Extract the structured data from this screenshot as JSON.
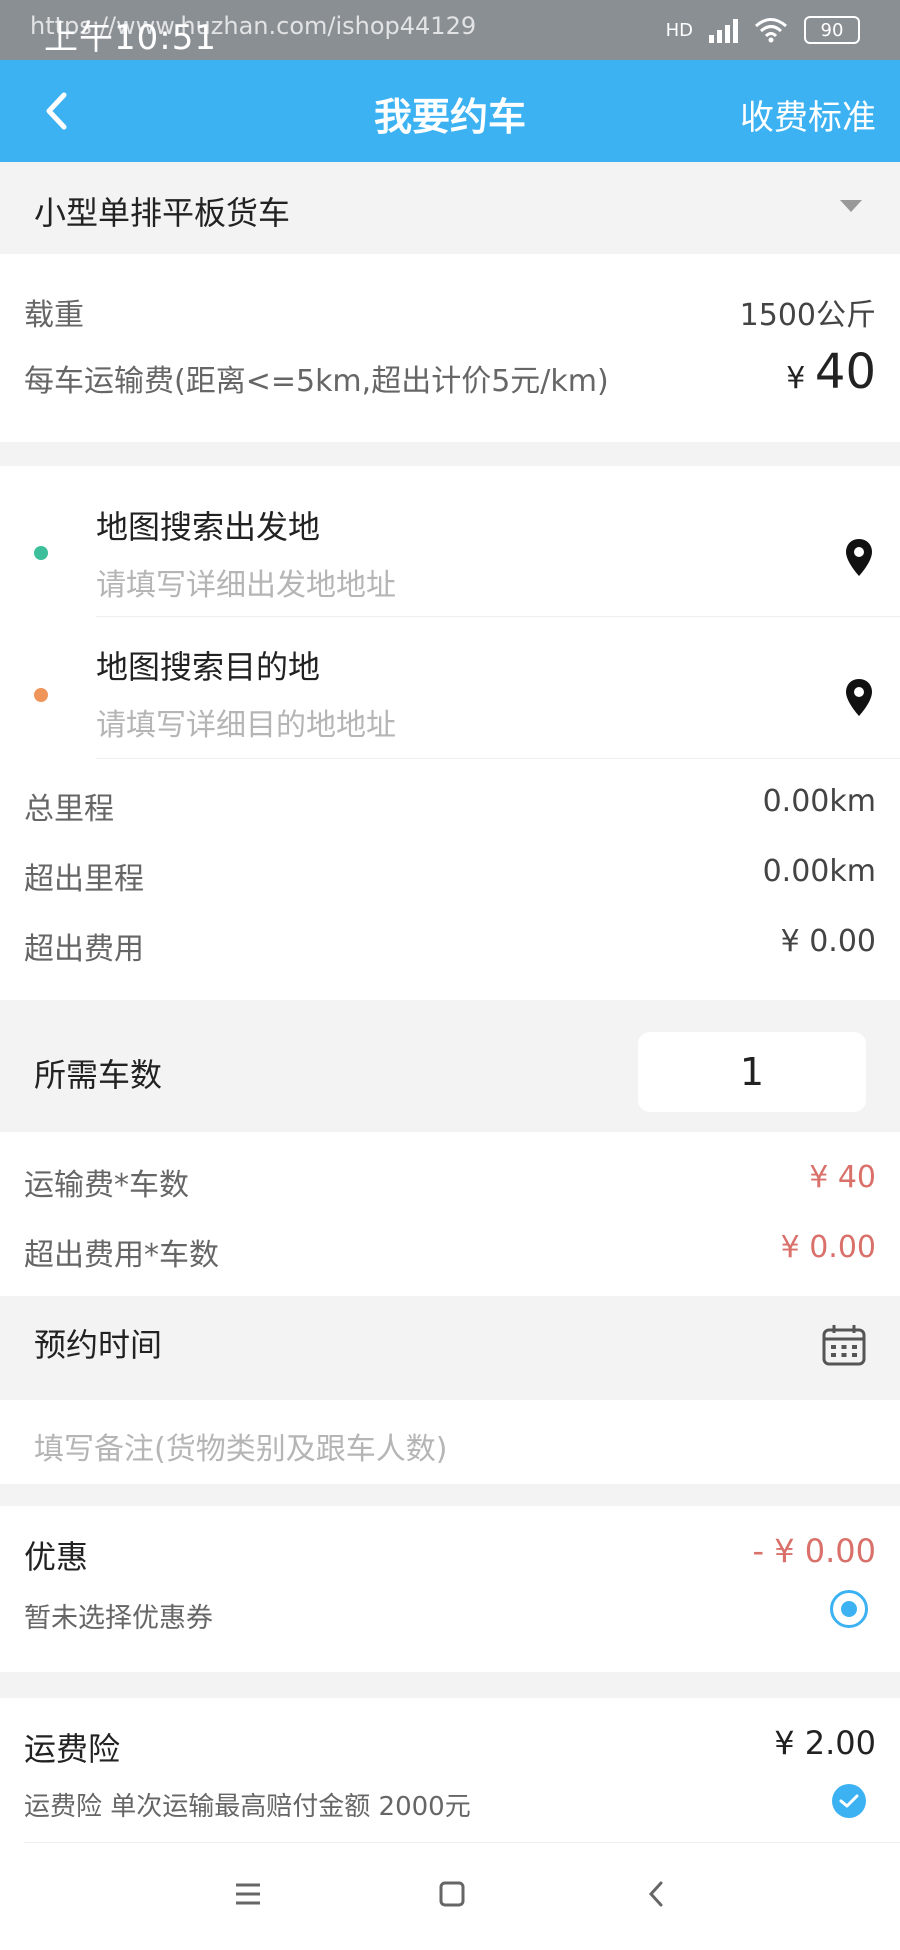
{
  "status_bar": {
    "time": "上午10:51",
    "watermark": "https://www.huzhan.com/ishop44129",
    "network": "HD",
    "battery": "90"
  },
  "header": {
    "title": "我要约车",
    "right_link": "收费标准"
  },
  "vehicle": {
    "selected": "小型单排平板货车"
  },
  "info": {
    "load_label": "载重",
    "load_value": "1500公斤",
    "fee_label": "每车运输费(距离<=5km,超出计价5元/km)",
    "fee_currency": "¥",
    "fee_value": "40"
  },
  "route": {
    "start_title": "地图搜索出发地",
    "start_placeholder": "请填写详细出发地地址",
    "end_title": "地图搜索目的地",
    "end_placeholder": "请填写详细目的地地址",
    "start_dot_color": "#3cbf9a",
    "end_dot_color": "#f0955a"
  },
  "distance": {
    "total_label": "总里程",
    "total_value": "0.00km",
    "over_label": "超出里程",
    "over_value": "0.00km",
    "over_fee_label": "超出费用",
    "over_fee_value": "¥ 0.00"
  },
  "cars": {
    "label": "所需车数",
    "count": "1"
  },
  "totals": {
    "fee_x_cars_label": "运输费*车数",
    "fee_x_cars_value": "¥ 40",
    "over_x_cars_label": "超出费用*车数",
    "over_x_cars_value": "¥ 0.00"
  },
  "booking": {
    "time_label": "预约时间",
    "note_placeholder": "填写备注(货物类别及跟车人数)"
  },
  "coupon": {
    "title": "优惠",
    "value": "- ¥ 0.00",
    "subtitle": "暂未选择优惠券"
  },
  "insurance": {
    "title": "运费险",
    "value": "¥ 2.00",
    "subtitle": "运费险 单次运输最高赔付金额 2000元"
  },
  "colors": {
    "primary": "#3cb2f2",
    "price_red": "#d9706a"
  }
}
